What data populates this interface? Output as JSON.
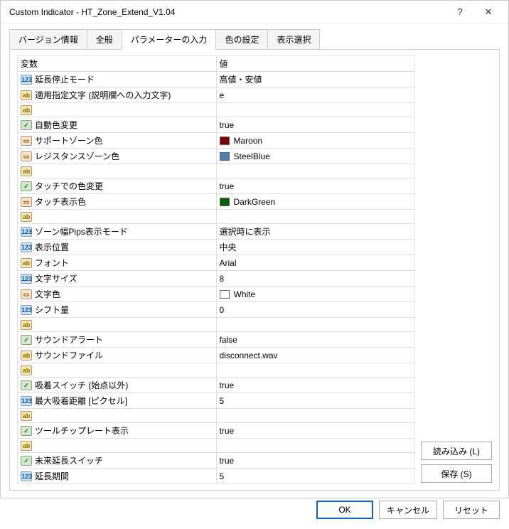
{
  "window": {
    "title": "Custom Indicator - HT_Zone_Extend_V1.04"
  },
  "tabs": {
    "t0": "バージョン情報",
    "t1": "全般",
    "t2": "パラメーターの入力",
    "t3": "色の設定",
    "t4": "表示選択"
  },
  "headers": {
    "var": "変数",
    "val": "値"
  },
  "rows": [
    {
      "type": "int",
      "name": "延長停止モード",
      "val": "高値・安値"
    },
    {
      "type": "str",
      "name": "適用指定文字 (説明欄への入力文字)",
      "val": "e"
    },
    {
      "type": "str",
      "name": "",
      "val": ""
    },
    {
      "type": "bool",
      "name": "自動色変更",
      "val": "true"
    },
    {
      "type": "color",
      "name": "サポートゾーン色",
      "val": "Maroon",
      "hex": "#800000"
    },
    {
      "type": "color",
      "name": "レジスタンスゾーン色",
      "val": "SteelBlue",
      "hex": "#4682b4"
    },
    {
      "type": "str",
      "name": "",
      "val": ""
    },
    {
      "type": "bool",
      "name": "タッチでの色変更",
      "val": "true"
    },
    {
      "type": "color",
      "name": "タッチ表示色",
      "val": "DarkGreen",
      "hex": "#006400"
    },
    {
      "type": "str",
      "name": "",
      "val": ""
    },
    {
      "type": "int",
      "name": "ゾーン幅Pips表示モード",
      "val": "選択時に表示"
    },
    {
      "type": "int",
      "name": "表示位置",
      "val": "中央"
    },
    {
      "type": "str",
      "name": "フォント",
      "val": "Arial"
    },
    {
      "type": "int",
      "name": "文字サイズ",
      "val": "8"
    },
    {
      "type": "color",
      "name": "文字色",
      "val": "White",
      "hex": "#ffffff"
    },
    {
      "type": "int",
      "name": "シフト量",
      "val": "0"
    },
    {
      "type": "str",
      "name": "",
      "val": ""
    },
    {
      "type": "bool",
      "name": "サウンドアラート",
      "val": "false"
    },
    {
      "type": "str",
      "name": "サウンドファイル",
      "val": "disconnect.wav"
    },
    {
      "type": "str",
      "name": "",
      "val": ""
    },
    {
      "type": "bool",
      "name": "吸着スイッチ (始点以外)",
      "val": "true"
    },
    {
      "type": "int",
      "name": "最大吸着距離 [ピクセル]",
      "val": "5"
    },
    {
      "type": "str",
      "name": "",
      "val": ""
    },
    {
      "type": "bool",
      "name": "ツールチップレート表示",
      "val": "true"
    },
    {
      "type": "str",
      "name": "",
      "val": ""
    },
    {
      "type": "bool",
      "name": "未来延長スイッチ",
      "val": "true"
    },
    {
      "type": "int",
      "name": "延長期間",
      "val": "5"
    }
  ],
  "side": {
    "load": "読み込み (L)",
    "save": "保存 (S)"
  },
  "footer": {
    "ok": "OK",
    "cancel": "キャンセル",
    "reset": "リセット"
  },
  "type_labels": {
    "int": "123",
    "str": "ab",
    "bool": "✓",
    "color": "▭",
    "enum": "◧"
  }
}
